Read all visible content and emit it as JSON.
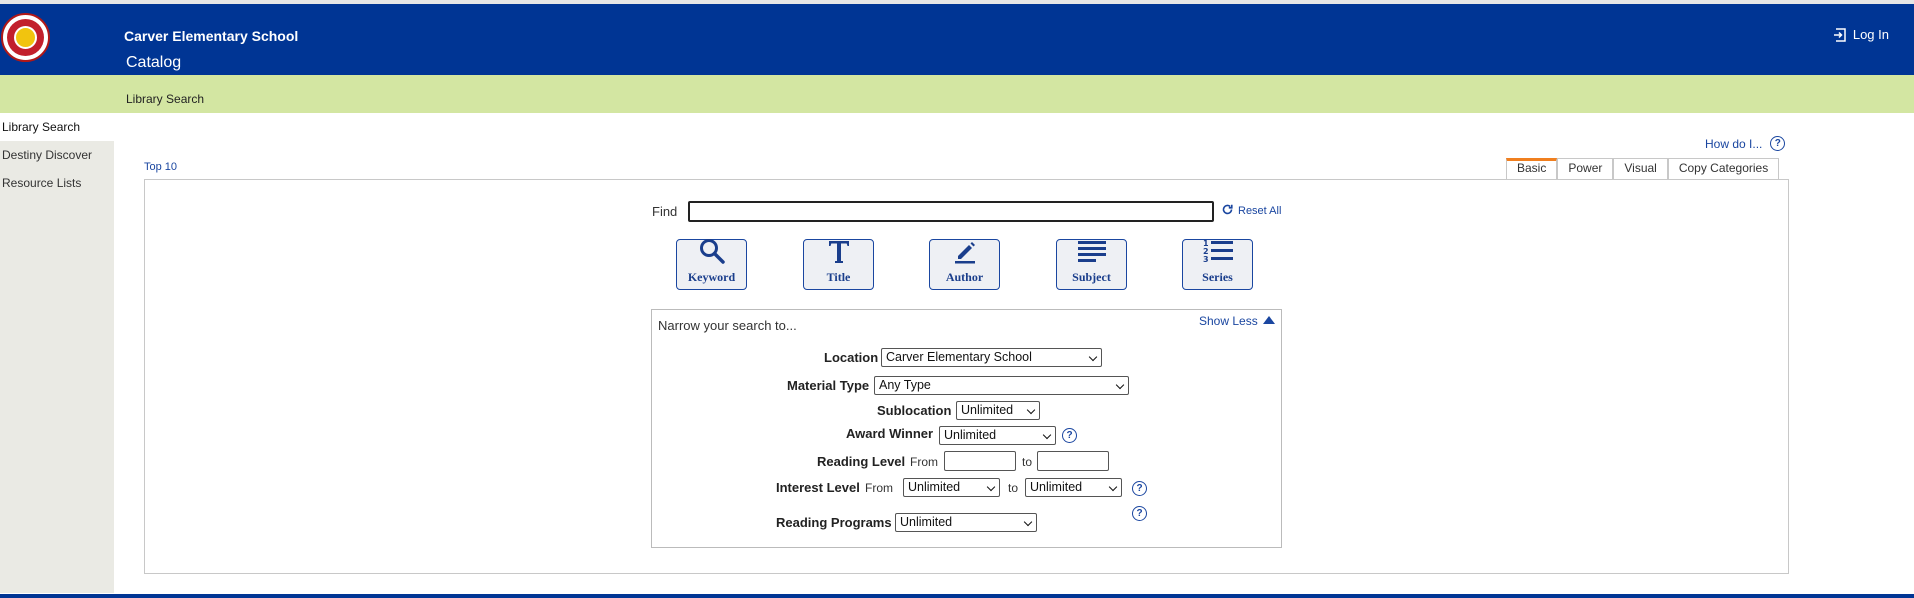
{
  "header": {
    "school_name": "Carver Elementary School",
    "catalog_tab": "Catalog",
    "login_label": "Log In"
  },
  "subbar": {
    "breadcrumb": "Library Search"
  },
  "sidebar": {
    "items": [
      {
        "label": "Library Search"
      },
      {
        "label": "Destiny Discover"
      },
      {
        "label": "Resource Lists"
      }
    ]
  },
  "help": {
    "how_do_i": "How do I...",
    "help_glyph": "?"
  },
  "top10": "Top 10",
  "search_tabs": [
    {
      "label": "Basic"
    },
    {
      "label": "Power"
    },
    {
      "label": "Visual"
    },
    {
      "label": "Copy Categories"
    }
  ],
  "find": {
    "label": "Find",
    "value": "",
    "reset_label": "Reset All"
  },
  "search_buttons": [
    {
      "label": "Keyword",
      "icon": "magnifier-icon"
    },
    {
      "label": "Title",
      "icon": "title-t-icon"
    },
    {
      "label": "Author",
      "icon": "pencil-icon"
    },
    {
      "label": "Subject",
      "icon": "lines-icon"
    },
    {
      "label": "Series",
      "icon": "numbered-list-icon"
    }
  ],
  "narrow": {
    "title": "Narrow your search to...",
    "show_less": "Show Less",
    "location": {
      "label": "Location",
      "value": "Carver Elementary School"
    },
    "material_type": {
      "label": "Material Type",
      "value": "Any Type"
    },
    "sublocation": {
      "label": "Sublocation",
      "value": "Unlimited"
    },
    "award_winner": {
      "label": "Award Winner",
      "value": "Unlimited"
    },
    "reading_level": {
      "label": "Reading Level",
      "from": "From",
      "to": "to",
      "from_value": "",
      "to_value": ""
    },
    "interest_level": {
      "label": "Interest Level",
      "from": "From",
      "to": "to",
      "from_value": "Unlimited",
      "to_value": "Unlimited"
    },
    "reading_programs": {
      "label": "Reading Programs",
      "value": "Unlimited"
    }
  },
  "colors": {
    "header_bg": "#003594",
    "subbar_bg": "#d3e6a2",
    "accent_orange": "#f07f1f",
    "link_blue": "#1a46a0"
  }
}
